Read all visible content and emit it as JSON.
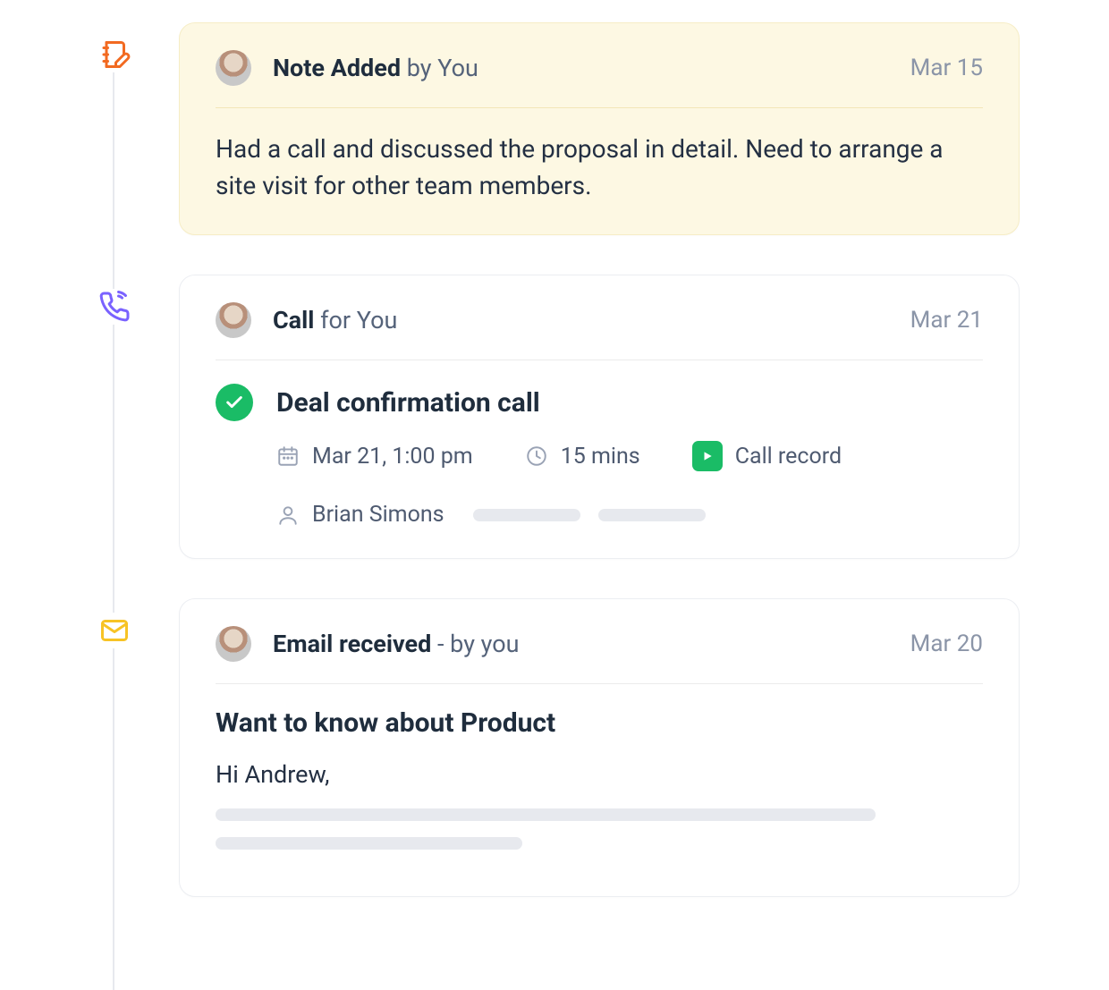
{
  "items": [
    {
      "type": "note",
      "title_strong": "Note Added",
      "title_light": " by You",
      "date": "Mar 15",
      "body": "Had a call and discussed the proposal in detail. Need to arrange a site visit for other team members."
    },
    {
      "type": "call",
      "title_strong": "Call",
      "title_light": " for You",
      "date": "Mar 21",
      "call_title": "Deal confirmation call",
      "call_datetime": "Mar 21, 1:00 pm",
      "call_duration": "15 mins",
      "call_record_label": "Call record",
      "person": "Brian Simons"
    },
    {
      "type": "email",
      "title_strong": "Email received",
      "title_light": " - by you",
      "date": "Mar 20",
      "subject": "Want to know about Product",
      "greeting": "Hi Andrew,"
    }
  ],
  "colors": {
    "note_icon": "#f26a21",
    "call_icon": "#7a62ff",
    "email_icon": "#f7c325",
    "success": "#1abc66"
  }
}
